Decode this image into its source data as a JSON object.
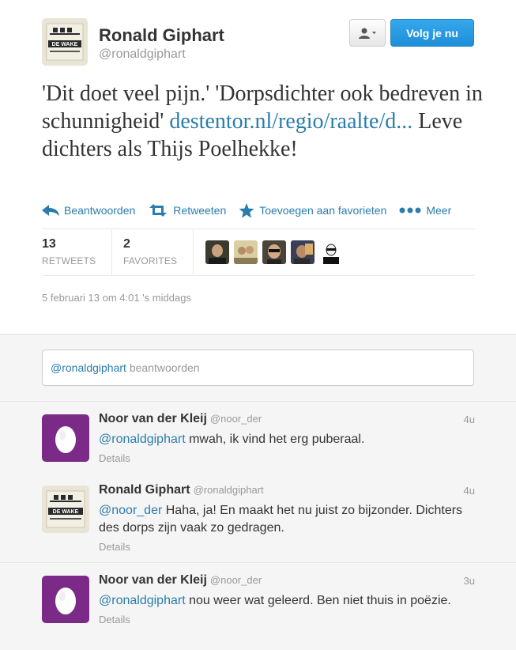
{
  "tweet": {
    "author_name": "Ronald Giphart",
    "author_handle": "@ronaldgiphart",
    "avatar_text": "DE WAKE",
    "follow_label": "Volg je nu",
    "text_part1": "'Dit doet veel pijn.' 'Dorpsdichter ook bedreven in schunnigheid' ",
    "link": "destentor.nl/regio/raalte/d...",
    "text_part2": " Leve dichters als Thijs Poelhekke!",
    "actions": {
      "reply": "Beantwoorden",
      "retweet": "Retweeten",
      "favorite": "Toevoegen aan favorieten",
      "more": "Meer"
    },
    "stats": {
      "retweets_count": "13",
      "retweets_label": "RETWEETS",
      "favorites_count": "2",
      "favorites_label": "FAVORITES"
    },
    "timestamp": "5 februari 13 om 4:01 's middags"
  },
  "reply_box": {
    "mention": "@ronaldgiphart",
    "placeholder": " beantwoorden"
  },
  "replies": [
    {
      "name": "Noor van der Kleij",
      "handle": "@noor_der",
      "time": "4u",
      "mention": "@ronaldgiphart",
      "text": " mwah, ik vind het erg puberaal.",
      "details": "Details"
    },
    {
      "name": "Ronald Giphart",
      "handle": "@ronaldgiphart",
      "time": "4u",
      "mention": "@noor_der",
      "text": " Haha, ja! En maakt het nu juist zo bijzonder. Dichters des dorps zijn vaak zo gedragen.",
      "details": "Details"
    },
    {
      "name": "Noor van der Kleij",
      "handle": "@noor_der",
      "time": "3u",
      "mention": "@ronaldgiphart",
      "text": " nou weer wat geleerd. Ben niet thuis in poëzie.",
      "details": "Details"
    }
  ],
  "colors": {
    "link": "#2a7dad",
    "follow_button": "#1d8ed8",
    "egg_avatar_bg": "#7b2b87"
  }
}
